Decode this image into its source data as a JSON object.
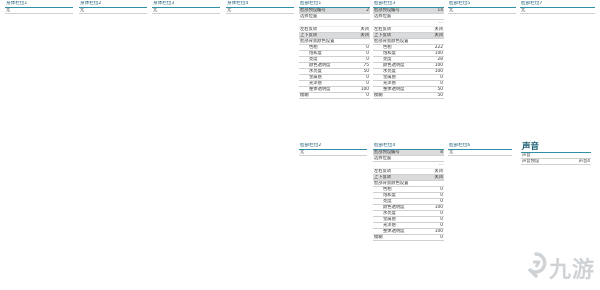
{
  "bodyslots": [
    {
      "title": "身体栏位1",
      "row": "无"
    },
    {
      "title": "身体栏位2",
      "row": "无"
    },
    {
      "title": "身体栏位3",
      "row": "无"
    },
    {
      "title": "身体栏位4",
      "row": "无"
    }
  ],
  "hair1": {
    "title": "脸部栏位1",
    "rows": [
      {
        "label": "脸部预设编号",
        "value": "2"
      },
      {
        "label": "选择位置",
        "value": ""
      },
      {
        "label": "",
        "value": ""
      },
      {
        "label": "左右反转",
        "value": "关闭"
      },
      {
        "label": "上下反转",
        "value": "关闭"
      },
      {
        "label": "脸部背景颜色设置",
        "value": ""
      }
    ],
    "sub": [
      {
        "label": "色相",
        "value": "0"
      },
      {
        "label": "饱和度",
        "value": "0"
      },
      {
        "label": "亮度",
        "value": "0"
      },
      {
        "label": "颜色透明度",
        "value": "75"
      },
      {
        "label": "水亮度",
        "value": "50"
      },
      {
        "label": "金属感",
        "value": "0"
      },
      {
        "label": "光泽感",
        "value": "0"
      },
      {
        "label": "整体透明度",
        "value": "100"
      }
    ],
    "last": {
      "label": "模糊",
      "value": "0"
    }
  },
  "hair3": {
    "title": "脸部栏位3",
    "rows": [
      {
        "label": "脸部预设编号",
        "value": "14"
      },
      {
        "label": "选择位置",
        "value": ""
      },
      {
        "label": "",
        "value": "..."
      },
      {
        "label": "左右反转",
        "value": "关闭"
      },
      {
        "label": "上下反转",
        "value": "关闭"
      },
      {
        "label": "脸部背景颜色设置",
        "value": ""
      }
    ],
    "sub": [
      {
        "label": "色相",
        "value": "222"
      },
      {
        "label": "饱和度",
        "value": "100"
      },
      {
        "label": "亮度",
        "value": "28"
      },
      {
        "label": "颜色透明度",
        "value": "100"
      },
      {
        "label": "水亮度",
        "value": "100"
      },
      {
        "label": "金属感",
        "value": "0"
      },
      {
        "label": "光泽感",
        "value": "0"
      },
      {
        "label": "整体透明度",
        "value": "50"
      }
    ],
    "last": {
      "label": "模糊",
      "value": "50"
    }
  },
  "hair5": {
    "title": "脸部栏位5",
    "row": "无"
  },
  "hair7": {
    "title": "脸部栏位7",
    "row": "无"
  },
  "hair2": {
    "title": "脸部栏位2",
    "row": "无"
  },
  "hair4": {
    "title": "脸部栏位4",
    "rows": [
      {
        "label": "脸部预设编号",
        "value": "8"
      },
      {
        "label": "选择位置",
        "value": ""
      },
      {
        "label": "",
        "value": "..."
      },
      {
        "label": "左右反转",
        "value": "关闭"
      },
      {
        "label": "上下反转",
        "value": "关闭"
      },
      {
        "label": "脸部背景颜色设置",
        "value": ""
      }
    ],
    "sub": [
      {
        "label": "色相",
        "value": "0"
      },
      {
        "label": "饱和度",
        "value": "0"
      },
      {
        "label": "亮度",
        "value": "0"
      },
      {
        "label": "颜色透明度",
        "value": "100"
      },
      {
        "label": "水亮度",
        "value": "0"
      },
      {
        "label": "金属感",
        "value": "0"
      },
      {
        "label": "光泽感",
        "value": "0"
      },
      {
        "label": "整体透明度",
        "value": "100"
      }
    ],
    "last": {
      "label": "模糊",
      "value": "0"
    }
  },
  "hair6": {
    "title": "脸部栏位6",
    "row": "无"
  },
  "sound": {
    "title": "声音",
    "rows": [
      {
        "label": "声音",
        "value": ""
      },
      {
        "label": "声音预设",
        "value": "声音4"
      }
    ]
  },
  "watermark": {
    "text": "九游"
  },
  "colors": {
    "accent": "#2f8fa6",
    "header_text": "#1d5e74",
    "selected_row": "#d9dbdd"
  }
}
